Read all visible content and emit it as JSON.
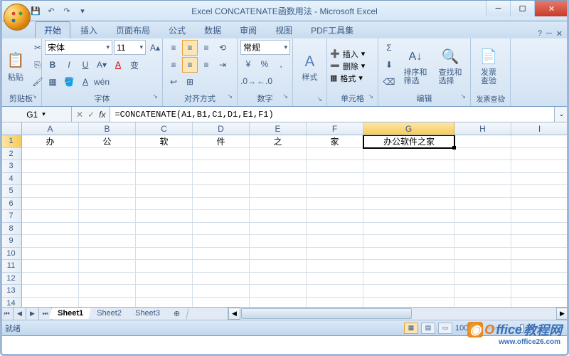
{
  "title": "Excel CONCATENATE函数用法 - Microsoft Excel",
  "tabs": [
    "开始",
    "插入",
    "页面布局",
    "公式",
    "数据",
    "审阅",
    "视图",
    "PDF工具集"
  ],
  "active_tab": 0,
  "ribbon": {
    "clipboard": {
      "paste": "粘贴",
      "label": "剪贴板"
    },
    "font": {
      "name": "宋体",
      "size": "11",
      "label": "字体"
    },
    "align": {
      "label": "对齐方式"
    },
    "number": {
      "format": "常规",
      "label": "数字"
    },
    "styles": {
      "btn": "样式",
      "label": ""
    },
    "cells": {
      "insert": "插入",
      "delete": "删除",
      "format": "格式",
      "label": "单元格"
    },
    "editing": {
      "sort": "排序和\n筛选",
      "find": "查找和\n选择",
      "label": "编辑"
    },
    "invoice": {
      "btn": "发票\n查验",
      "label": "发票查验"
    }
  },
  "name_box": "G1",
  "formula": "=CONCATENATE(A1,B1,C1,D1,E1,F1)",
  "columns": [
    "A",
    "B",
    "C",
    "D",
    "E",
    "F",
    "G",
    "H",
    "I"
  ],
  "selected_col": "G",
  "rows": 14,
  "selected_row": 1,
  "cells": {
    "A1": "办",
    "B1": "公",
    "C1": "软",
    "D1": "件",
    "E1": "之",
    "F1": "家",
    "G1": "办公软件之家"
  },
  "sheets": [
    "Sheet1",
    "Sheet2",
    "Sheet3"
  ],
  "active_sheet": 0,
  "status": "就绪",
  "zoom": "100%",
  "watermark": {
    "brand_o": "O",
    "brand": "ffice",
    "suffix": "教程网",
    "url": "www.office26.com"
  }
}
